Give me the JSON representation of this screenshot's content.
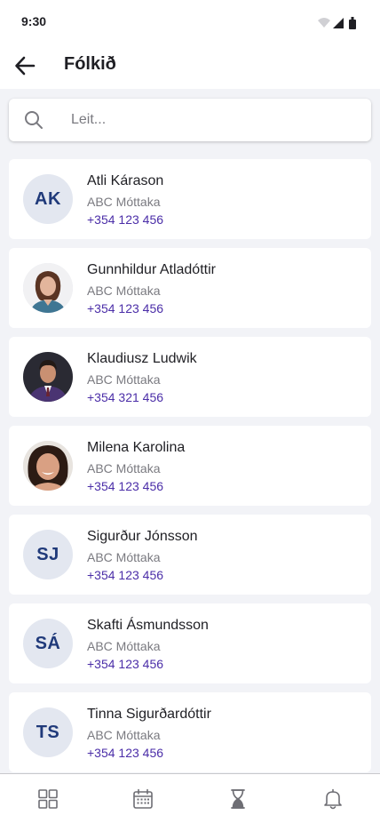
{
  "status": {
    "time": "9:30"
  },
  "header": {
    "title": "Fólkið",
    "back_icon": "arrow-left-icon"
  },
  "search": {
    "placeholder": "Leit...",
    "value": "",
    "icon": "search-icon"
  },
  "contacts": [
    {
      "name": "Atli Kárason",
      "org": "ABC Móttaka",
      "phone": "+354 123 456",
      "initials": "AK",
      "photo": false
    },
    {
      "name": "Gunnhildur Atladóttir",
      "org": "ABC Móttaka",
      "phone": "+354 123 456",
      "initials": "",
      "photo": true
    },
    {
      "name": "Klaudiusz Ludwik",
      "org": "ABC Móttaka",
      "phone": "+354 321 456",
      "initials": "",
      "photo": true
    },
    {
      "name": "Milena Karolina",
      "org": "ABC Móttaka",
      "phone": "+354 123 456",
      "initials": "",
      "photo": true
    },
    {
      "name": "Sigurður Jónsson",
      "org": "ABC Móttaka",
      "phone": "+354 123 456",
      "initials": "SJ",
      "photo": false
    },
    {
      "name": "Skafti Ásmundsson",
      "org": "ABC Móttaka",
      "phone": "+354 123 456",
      "initials": "SÁ",
      "photo": false
    },
    {
      "name": "Tinna Sigurðardóttir",
      "org": "ABC Móttaka",
      "phone": "+354 123 456",
      "initials": "TS",
      "photo": false
    }
  ],
  "bottom_nav": [
    {
      "icon": "grid-icon"
    },
    {
      "icon": "calendar-icon"
    },
    {
      "icon": "hourglass-icon"
    },
    {
      "icon": "bell-icon"
    }
  ],
  "colors": {
    "background": "#f2f3f7",
    "surface": "#ffffff",
    "initials_text": "#203a7a",
    "initials_bg": "#e3e7f0",
    "phone_text": "#4b2ea8",
    "secondary_text": "#7a7a80"
  }
}
